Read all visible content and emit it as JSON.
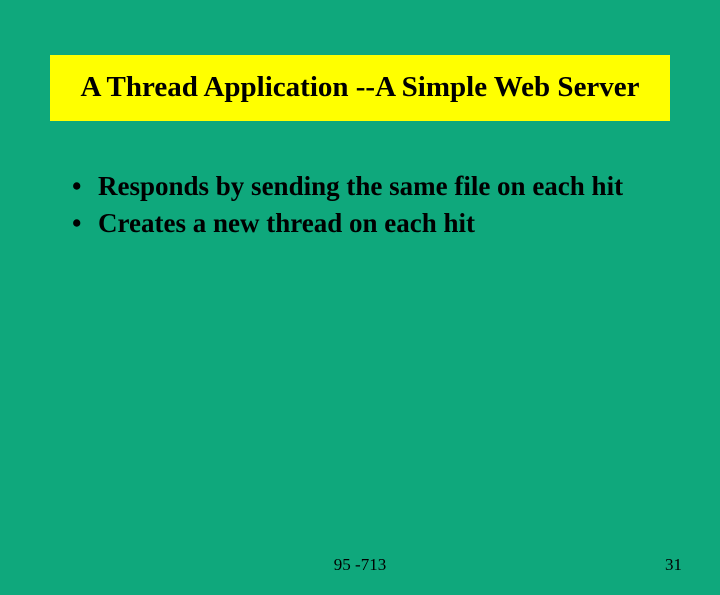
{
  "title": "A Thread Application --A Simple Web Server",
  "bullets": [
    "Responds by sending the same file on each hit",
    "Creates a new thread on each hit"
  ],
  "footer_center": "95 -713",
  "footer_right": "31"
}
